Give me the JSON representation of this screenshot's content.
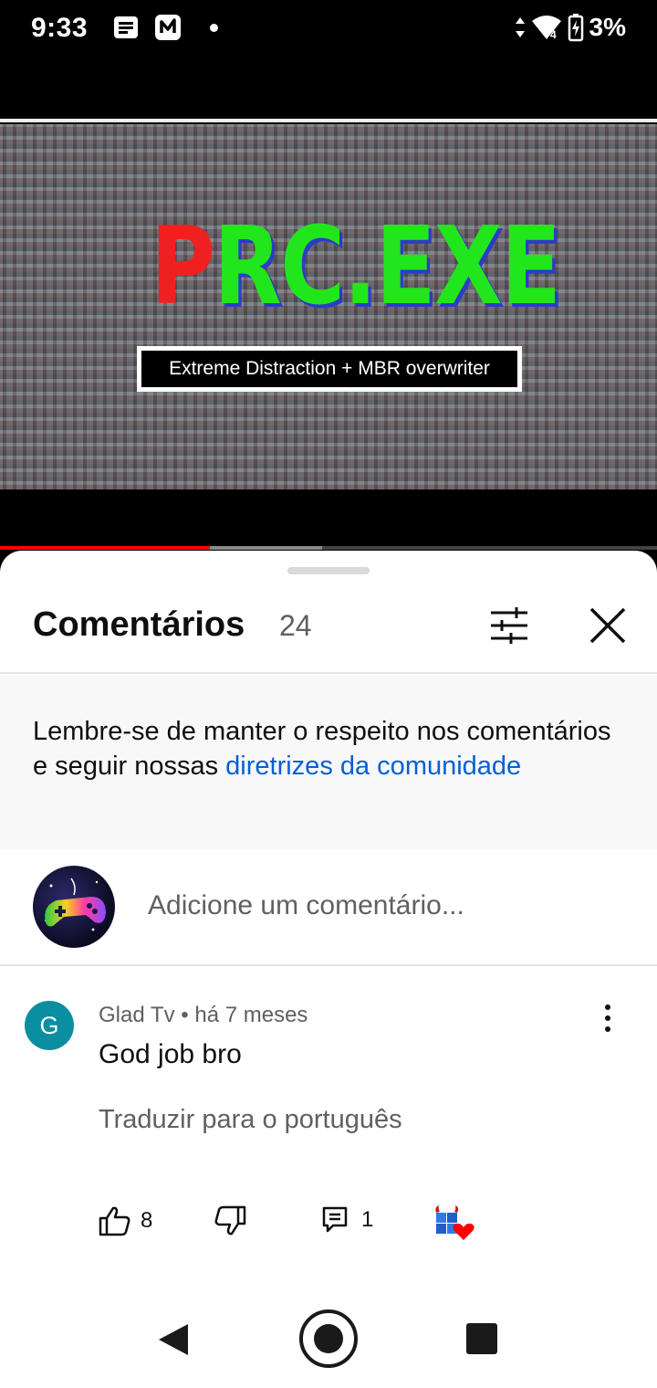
{
  "status_bar": {
    "time": "9:33",
    "battery": "3%",
    "network_badge": "4"
  },
  "video": {
    "thumbnail_title_red": "P",
    "thumbnail_title_green": "RC.EXE",
    "thumbnail_subtitle": "Extreme Distraction + MBR overwriter",
    "progress_played_fraction": 0.32,
    "progress_buffered_fraction": 0.49,
    "colors": {
      "progress": "#ff0000",
      "title_red": "#f02020",
      "title_green": "#22e61c"
    }
  },
  "comments_sheet": {
    "title": "Comentários",
    "count": "24",
    "notice_text": "Lembre-se de manter o respeito nos comentários e seguir nossas ",
    "notice_link": "diretrizes da comunidade",
    "add_placeholder": "Adicione um comentário...",
    "link_color": "#065fd4"
  },
  "comment": {
    "avatar_letter": "G",
    "author": "Glad Tv",
    "separator": " • ",
    "time": "há 7 meses",
    "text": "God job bro",
    "translate": "Traduzir para o português",
    "likes": "8",
    "replies": "1",
    "avatar_color": "#0b8ea0"
  }
}
